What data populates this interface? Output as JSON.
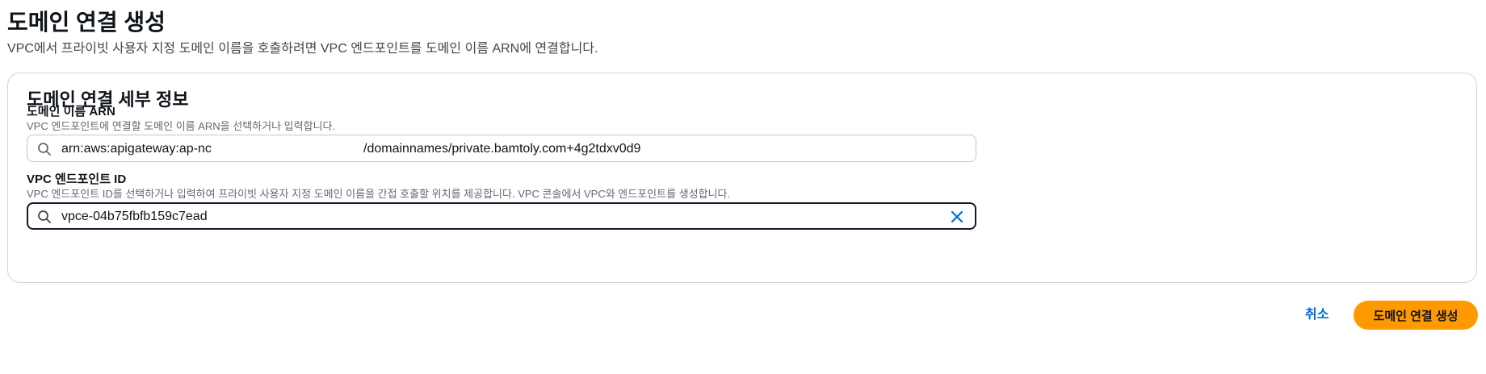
{
  "page": {
    "title": "도메인 연결 생성",
    "description": "VPC에서 프라이빗 사용자 지정 도메인 이름을 호출하려면 VPC 엔드포인트를 도메인 이름 ARN에 연결합니다."
  },
  "details": {
    "title": "도메인 연결 세부 정보",
    "domain_arn": {
      "label": "도메인 이름 ARN",
      "description": "VPC 엔드포인트에 연결할 도메인 이름 ARN을 선택하거나 입력합니다.",
      "value_part1": "arn:aws:apigateway:ap-nc",
      "value_part2": "/domainnames/private.bamtoly.com+4g2tdxv0d9"
    },
    "vpc_endpoint": {
      "label": "VPC 엔드포인트 ID",
      "description": "VPC 엔드포인트 ID를 선택하거나 입력하여 프라이빗 사용자 지정 도메인 이름을 간접 호출할 위치를 제공합니다. VPC 콘솔에서 VPC와 엔드포인트를 생성합니다.",
      "value": "vpce-04b75fbfb159c7ead"
    }
  },
  "actions": {
    "cancel_label": "취소",
    "submit_label": "도메인 연결 생성"
  },
  "icons": {
    "search": "search-icon",
    "clear": "close-icon"
  },
  "colors": {
    "primary_button": "#ff9900",
    "link": "#006ce0",
    "focused_border": "#0f1b2a",
    "clear_icon": "#006ce0"
  }
}
